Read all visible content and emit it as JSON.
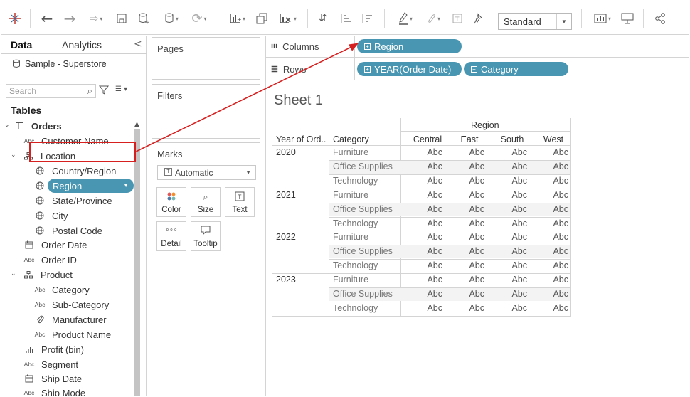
{
  "toolbar": {
    "format_select_value": "Standard",
    "icons": [
      "tableau-logo-icon",
      "undo-icon",
      "redo-icon",
      "replay-icon",
      "save-icon",
      "new-datasource-icon",
      "datasource-icon",
      "refresh-icon",
      "new-worksheet-icon",
      "duplicate-icon",
      "clear-icon",
      "swap-icon",
      "sort-ascending-icon",
      "sort-descending-icon",
      "highlight-icon",
      "group-icon",
      "label-icon",
      "pin-icon",
      "show-me-icon",
      "presentation-icon",
      "share-icon"
    ]
  },
  "left_pane": {
    "tabs": [
      {
        "label": "Data"
      },
      {
        "label": "Analytics"
      }
    ],
    "datasource": "Sample - Superstore",
    "search_placeholder": "Search",
    "tables_heading": "Tables",
    "fields": [
      {
        "label": "Orders",
        "icon": "table-icon"
      },
      {
        "label": "Customer Name",
        "icon": "Abc"
      },
      {
        "label": "Location",
        "icon": "hierarchy-icon"
      },
      {
        "label": "Country/Region",
        "icon": "globe-icon"
      },
      {
        "label": "Region",
        "icon": "globe-icon"
      },
      {
        "label": "State/Province",
        "icon": "globe-icon"
      },
      {
        "label": "City",
        "icon": "globe-icon"
      },
      {
        "label": "Postal Code",
        "icon": "globe-icon"
      },
      {
        "label": "Order Date",
        "icon": "calendar-icon"
      },
      {
        "label": "Order ID",
        "icon": "Abc"
      },
      {
        "label": "Product",
        "icon": "hierarchy-icon"
      },
      {
        "label": "Category",
        "icon": "Abc"
      },
      {
        "label": "Sub-Category",
        "icon": "Abc"
      },
      {
        "label": "Manufacturer",
        "icon": "paperclip-icon"
      },
      {
        "label": "Product Name",
        "icon": "Abc"
      },
      {
        "label": "Profit (bin)",
        "icon": "histogram-icon"
      },
      {
        "label": "Segment",
        "icon": "Abc"
      },
      {
        "label": "Ship Date",
        "icon": "calendar-icon"
      },
      {
        "label": "Ship Mode",
        "icon": "Abc"
      }
    ]
  },
  "shelves": {
    "pages_label": "Pages",
    "filters_label": "Filters",
    "marks_label": "Marks",
    "marks_type": "Automatic",
    "mark_buttons": [
      {
        "label": "Color",
        "icon": "color-icon"
      },
      {
        "label": "Size",
        "icon": "size-icon"
      },
      {
        "label": "Text",
        "icon": "text-icon"
      },
      {
        "label": "Detail",
        "icon": "detail-icon"
      },
      {
        "label": "Tooltip",
        "icon": "tooltip-icon"
      }
    ],
    "columns_label": "Columns",
    "rows_label": "Rows",
    "columns_pills": [
      "Region"
    ],
    "rows_pills": [
      "YEAR(Order Date)",
      "Category"
    ]
  },
  "sheet": {
    "title": "Sheet 1",
    "column_group_header": "Region",
    "row_headers": [
      "Year of Ord..",
      "Category"
    ],
    "regions": [
      "Central",
      "East",
      "South",
      "West"
    ],
    "years": [
      "2020",
      "2021",
      "2022",
      "2023"
    ],
    "categories": [
      "Furniture",
      "Office Supplies",
      "Technology"
    ],
    "cell_value": "Abc"
  },
  "annotation": {
    "color": "#d62020"
  }
}
